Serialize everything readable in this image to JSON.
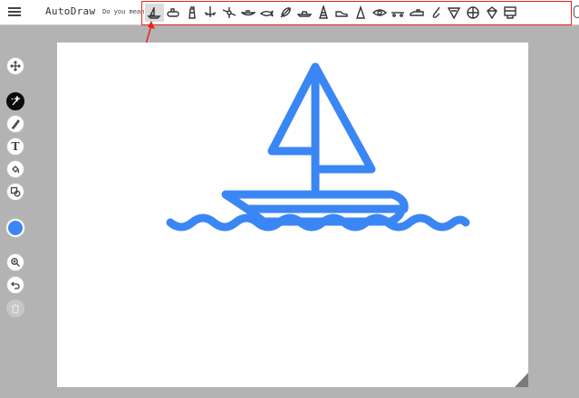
{
  "header": {
    "menu_icon": "hamburger-icon",
    "app_title": "AutoDraw",
    "did_you_mean": "Do you mean:",
    "suggestions": [
      "sailboat",
      "submarine",
      "lighthouse",
      "chandelier",
      "satellite",
      "canoe",
      "whale",
      "rocket",
      "submarine-2",
      "tower",
      "sneaker",
      "cone",
      "eye",
      "skateboard",
      "train",
      "saxophone",
      "pizza-slice",
      "soccer-ball",
      "diamond",
      "store"
    ],
    "selected_suggestion": "sailboat",
    "highlight_color": "#e8231f"
  },
  "tools": [
    {
      "name": "move-tool",
      "icon": "move-icon"
    },
    {
      "name": "autodraw-tool",
      "icon": "autodraw-icon",
      "active": true
    },
    {
      "name": "draw-tool",
      "icon": "pencil-icon"
    },
    {
      "name": "type-tool",
      "icon": "text-icon",
      "glyph": "T"
    },
    {
      "name": "fill-tool",
      "icon": "fill-icon"
    },
    {
      "name": "shape-tool",
      "icon": "shape-icon"
    },
    {
      "name": "color-tool",
      "icon": "color-icon",
      "color": "#3a86f4"
    },
    {
      "name": "zoom-tool",
      "icon": "zoom-icon"
    },
    {
      "name": "undo-tool",
      "icon": "undo-icon"
    },
    {
      "name": "delete-tool",
      "icon": "trash-icon",
      "disabled": true
    }
  ],
  "canvas": {
    "background": "#ffffff",
    "drawing": "sailboat",
    "stroke_color": "#3a86f4"
  }
}
